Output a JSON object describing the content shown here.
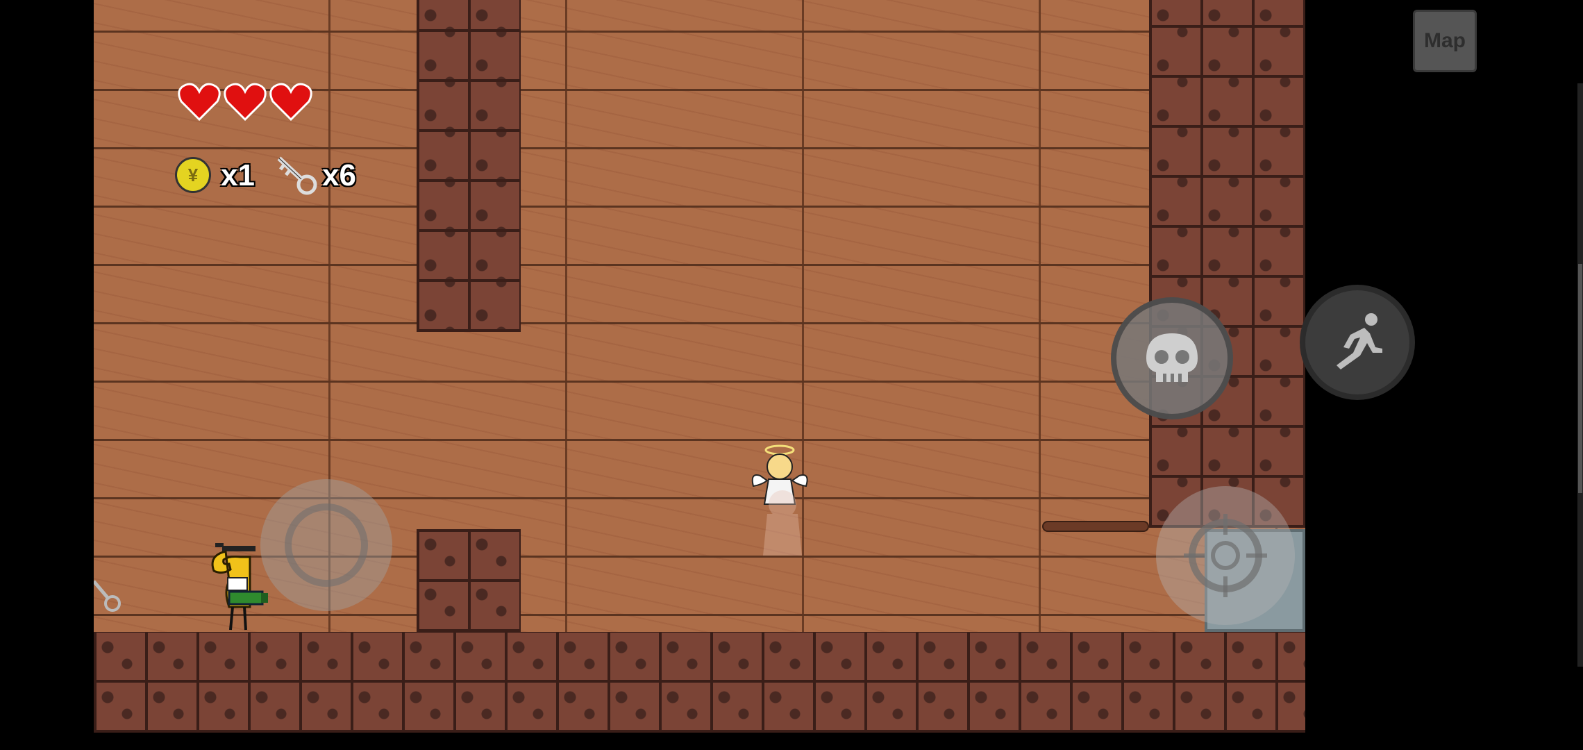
{
  "hud": {
    "hearts": 3,
    "coin_symbol": "¥",
    "coin_count": "x1",
    "key_count": "x6"
  },
  "buttons": {
    "map_label": "Map"
  },
  "icons": {
    "attack": "skull-icon",
    "dash": "running-man-icon",
    "aim": "crosshair-icon"
  },
  "colors": {
    "wood": "#ad6d48",
    "brick": "#7b4436",
    "heart": "#e01010",
    "coin": "#e4d421"
  }
}
